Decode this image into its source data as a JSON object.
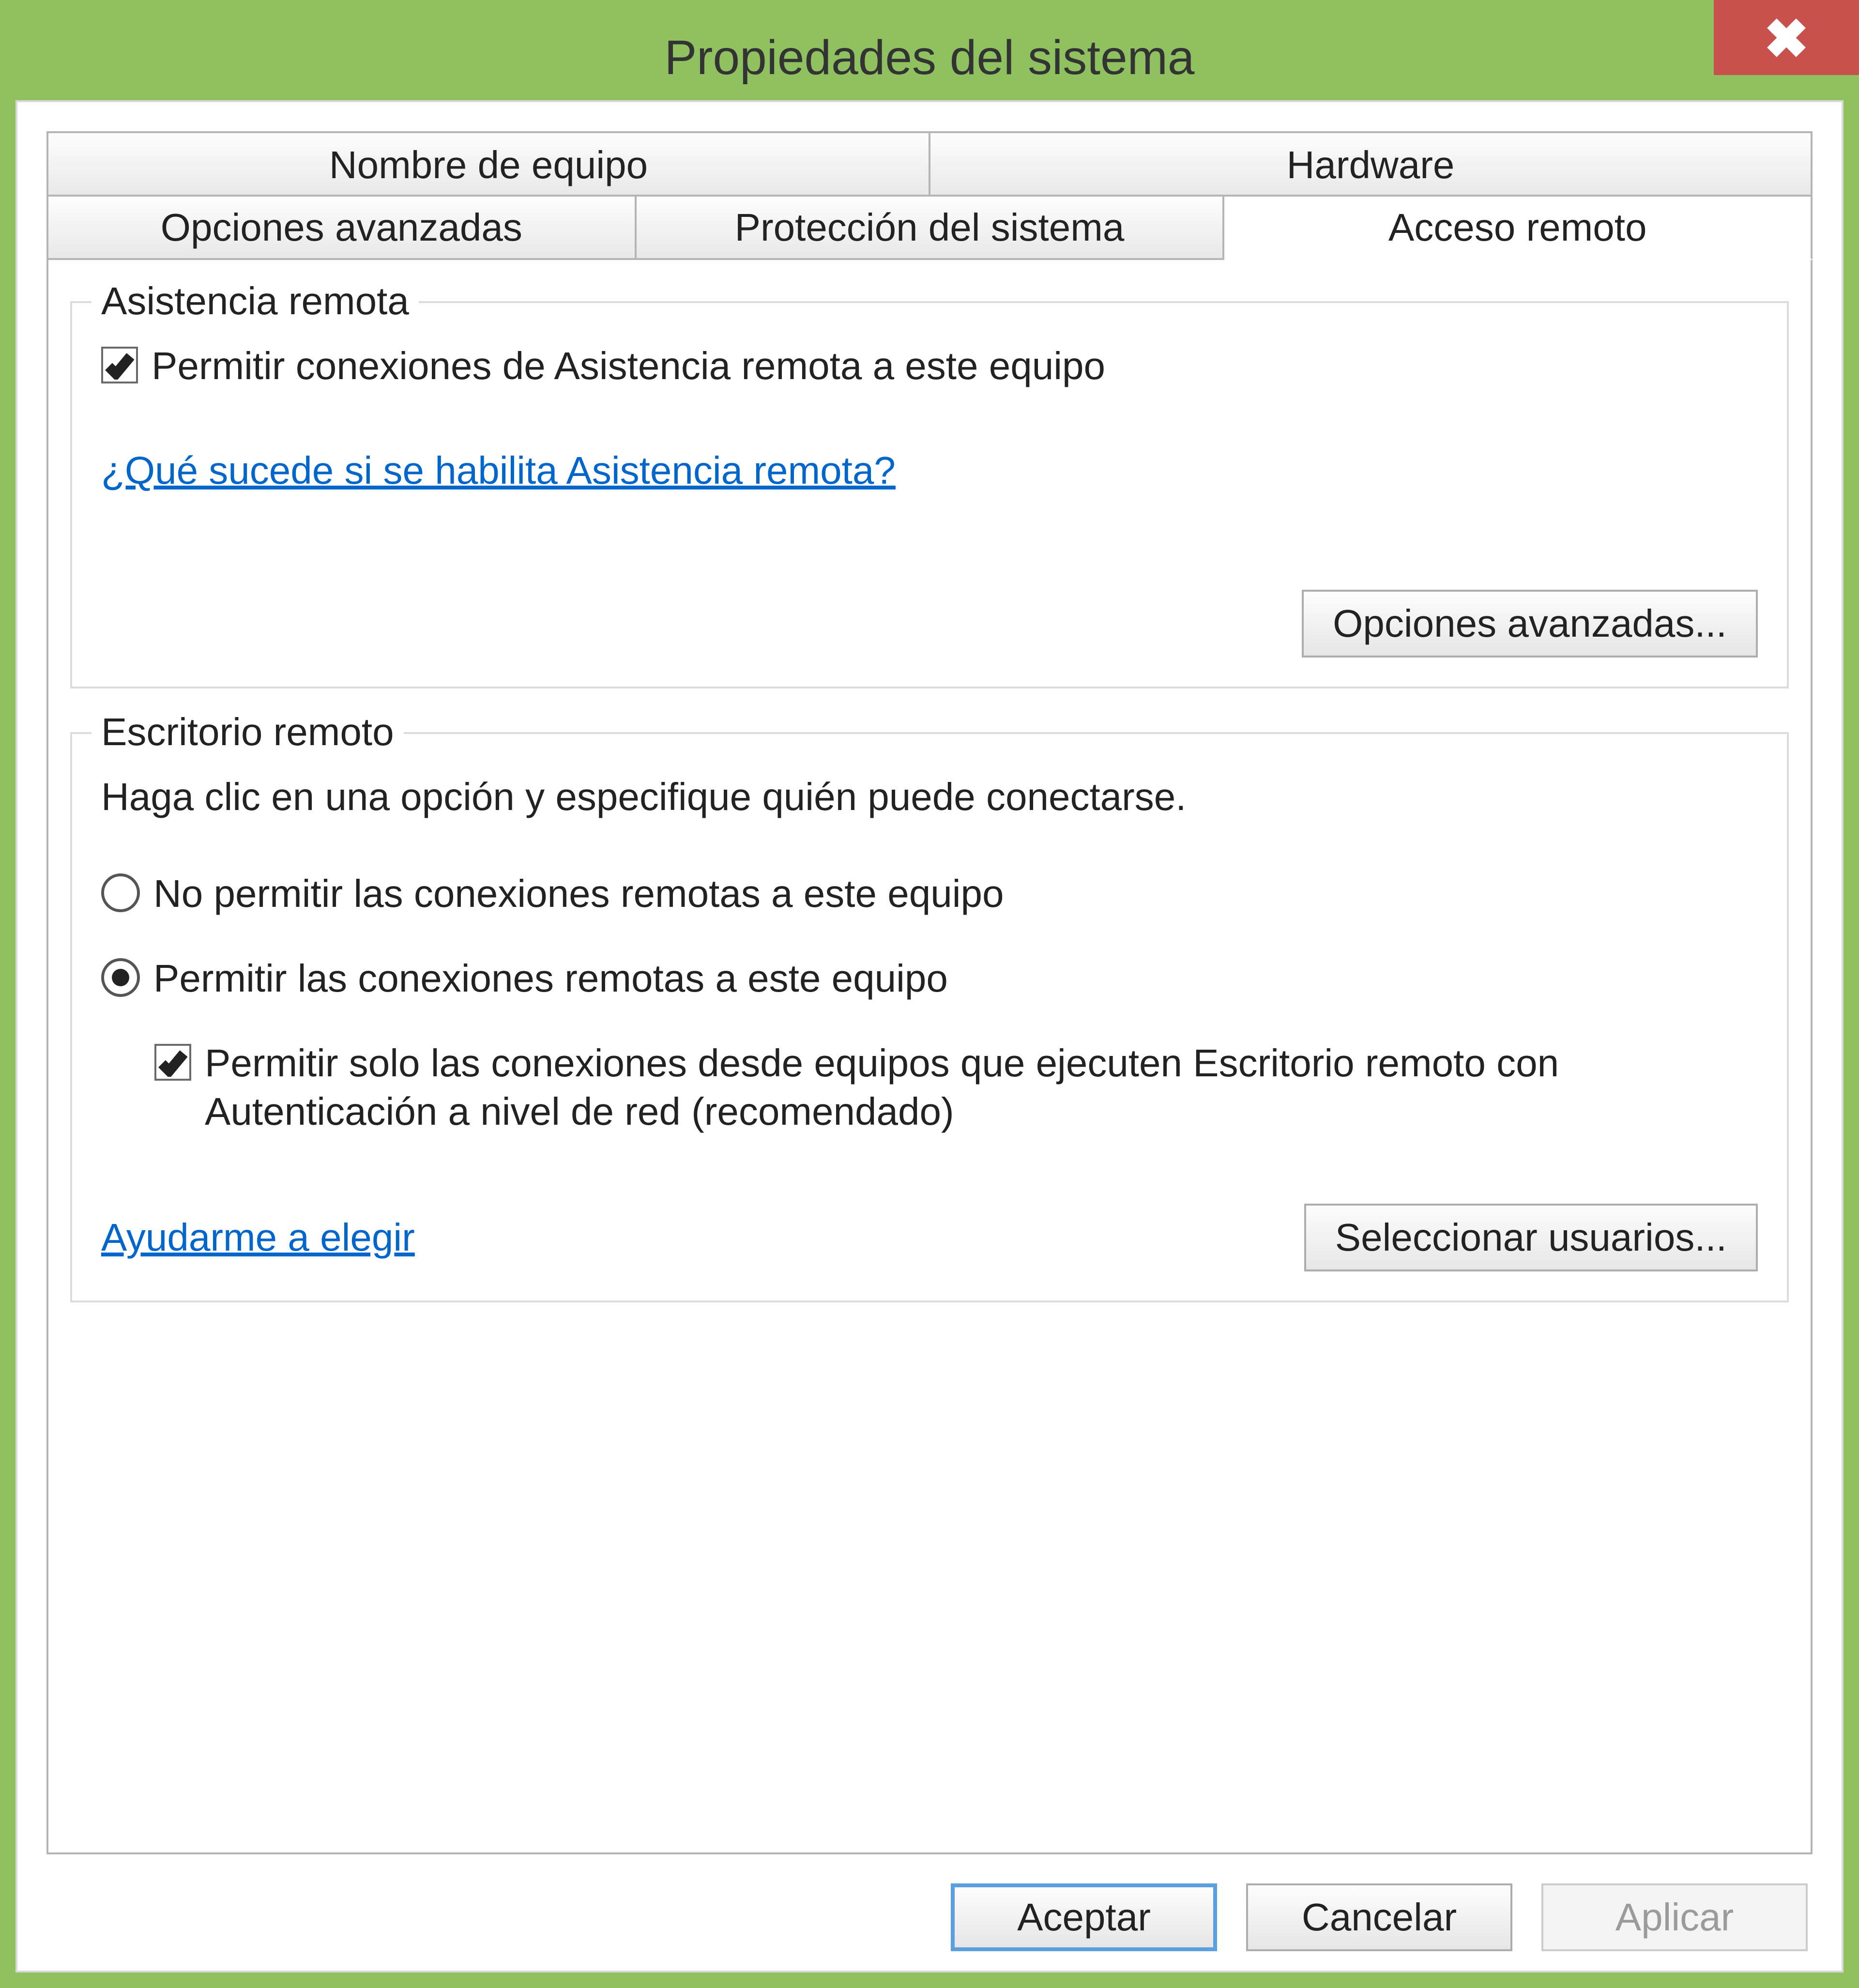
{
  "window": {
    "title": "Propiedades del sistema"
  },
  "tabs": {
    "row1": [
      "Nombre de equipo",
      "Hardware"
    ],
    "row2": [
      "Opciones avanzadas",
      "Protección del sistema",
      "Acceso remoto"
    ],
    "active": "Acceso remoto"
  },
  "remote_assistance": {
    "legend": "Asistencia remota",
    "allow_label": "Permitir conexiones de Asistencia remota a este equipo",
    "allow_checked": true,
    "help_link": "¿Qué sucede si se habilita Asistencia remota?",
    "advanced_button": "Opciones avanzadas..."
  },
  "remote_desktop": {
    "legend": "Escritorio remoto",
    "instruction": "Haga clic en una opción y especifique quién puede conectarse.",
    "option_disallow": "No permitir las conexiones remotas a este equipo",
    "option_allow": "Permitir las conexiones remotas a este equipo",
    "selected": "allow",
    "nla_label": "Permitir solo las conexiones desde equipos que ejecuten Escritorio remoto con Autenticación a nivel de red (recomendado)",
    "nla_checked": true,
    "help_link": "Ayudarme a elegir",
    "select_users_button": "Seleccionar usuarios..."
  },
  "buttons": {
    "ok": "Aceptar",
    "cancel": "Cancelar",
    "apply": "Aplicar"
  }
}
